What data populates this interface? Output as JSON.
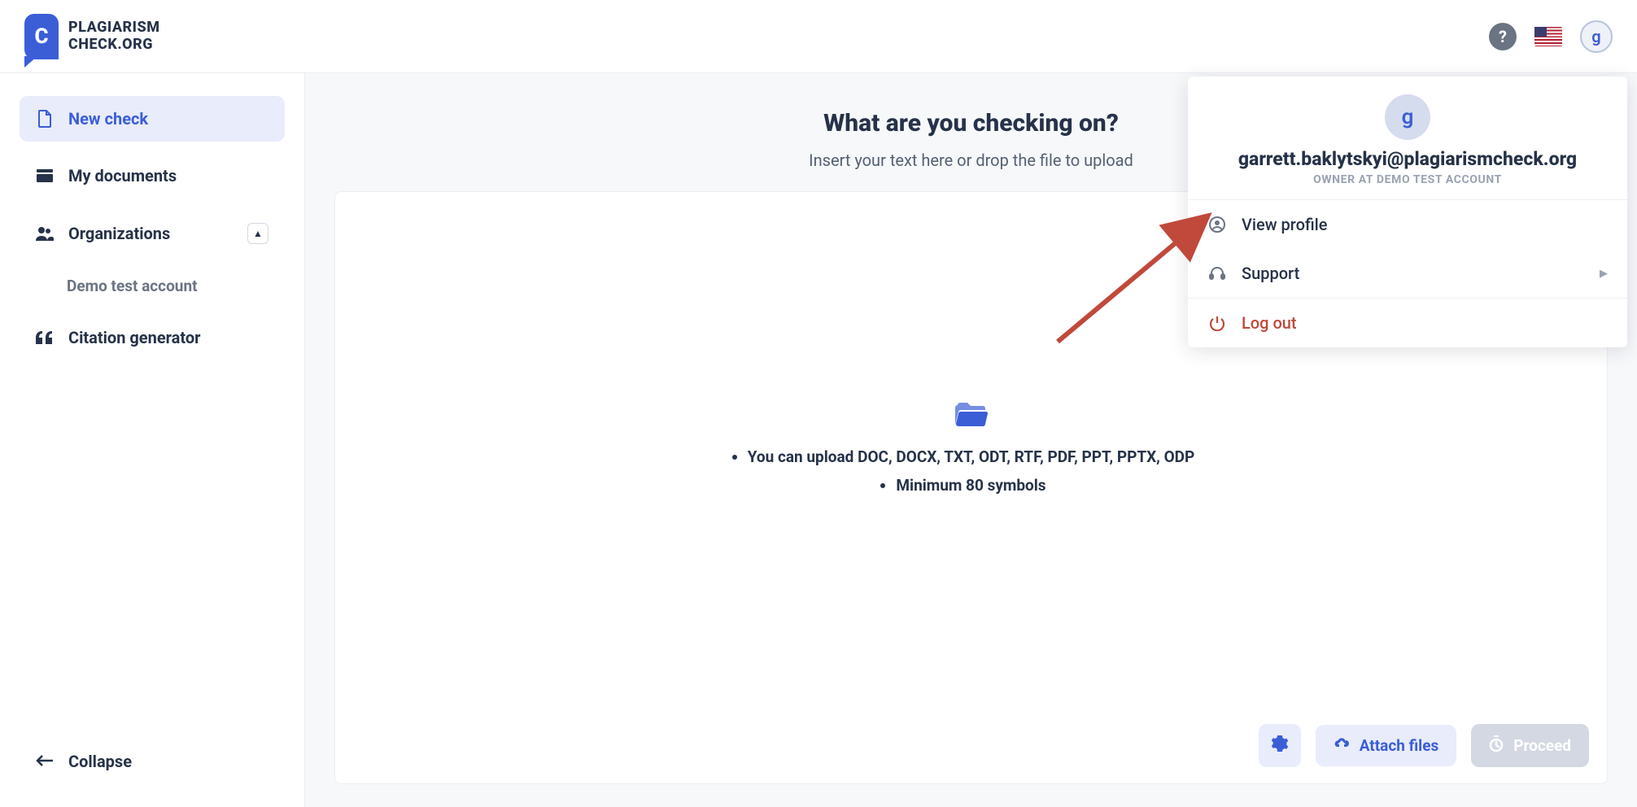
{
  "brand": {
    "line1": "PLAGIARISM",
    "line2": "CHECK.ORG"
  },
  "header": {
    "avatar_initial": "g"
  },
  "sidebar": {
    "items": [
      {
        "key": "new-check",
        "label": "New check"
      },
      {
        "key": "my-documents",
        "label": "My documents"
      },
      {
        "key": "organizations",
        "label": "Organizations"
      },
      {
        "key": "citation-generator",
        "label": "Citation generator"
      }
    ],
    "org_sub": "Demo test account",
    "collapse": "Collapse"
  },
  "main": {
    "heading": "What are you checking on?",
    "subheading": "Insert your text here or drop the file to upload",
    "hint1_prefix": "You can upload",
    "hint1_formats": "DOC, DOCX, TXT, ODT, RTF, PDF, PPT, PPTX, ODP",
    "hint2": "Minimum 80 symbols",
    "buttons": {
      "attach": "Attach files",
      "proceed": "Proceed"
    }
  },
  "menu": {
    "avatar_initial": "g",
    "email": "garrett.baklytskyi@plagiarismcheck.org",
    "role": "OWNER AT DEMO TEST ACCOUNT",
    "view_profile": "View profile",
    "support": "Support",
    "logout": "Log out"
  }
}
